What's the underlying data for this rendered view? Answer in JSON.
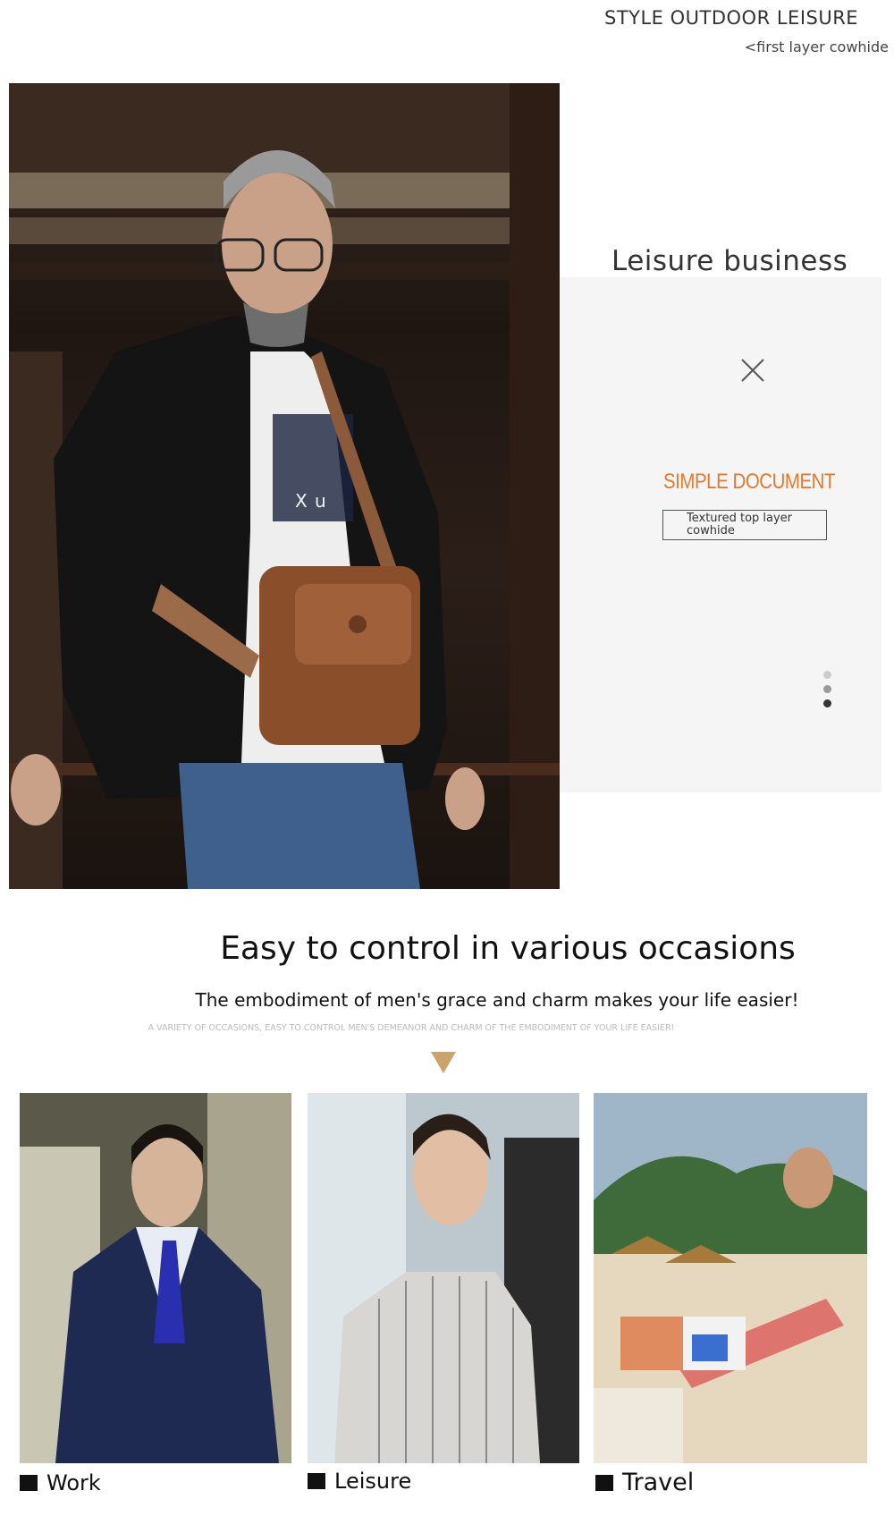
{
  "header": {
    "title": "STYLE OUTDOOR LEISURE",
    "subtitle": "<first layer cowhide"
  },
  "hero": {
    "caption": "X     u"
  },
  "feature": {
    "title": "Leisure business",
    "heading": "SIMPLE DOCUMENT",
    "tag": "Textured top layer cowhide",
    "close_icon": "close-icon",
    "dot_colors": [
      "#cccccc",
      "#999999",
      "#333333"
    ],
    "active_dot": 3
  },
  "occasions_section": {
    "title": "Easy to control in various occasions",
    "subtitle": "The embodiment of men's grace and charm makes your life easier!",
    "tagline": "A VARIETY OF OCCASIONS, EASY TO CONTROL MEN'S DEMEANOR AND CHARM OF THE EMBODIMENT OF YOUR LIFE EASIER!",
    "accent_color": "#c9a46b",
    "items": [
      {
        "label": "Work"
      },
      {
        "label": "Leisure"
      },
      {
        "label": "Travel"
      }
    ]
  }
}
